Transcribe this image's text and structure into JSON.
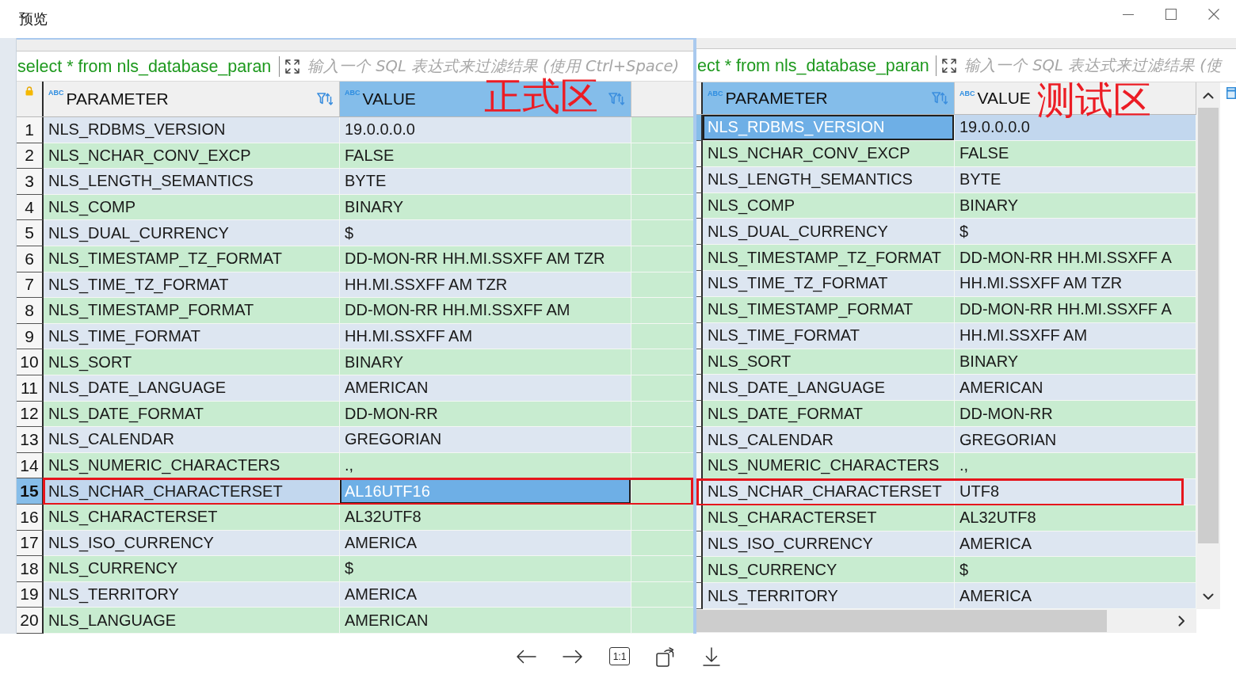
{
  "window": {
    "title": "预览"
  },
  "panels": [
    {
      "query": "select * from nls_database_paran",
      "filter_placeholder": "输入一个 SQL 表达式来过滤结果 (使用 Ctrl+Space)",
      "annotation": "正式区",
      "columns": [
        {
          "type": "ABC",
          "label": "PARAMETER",
          "selected": false,
          "filter_icon": true
        },
        {
          "type": "ABC",
          "label": "VALUE",
          "selected": true,
          "filter_icon": true
        }
      ],
      "rows": [
        {
          "number": "1",
          "selected": false,
          "outlined": false,
          "cells": [
            {
              "text": "NLS_RDBMS_VERSION",
              "selected": false
            },
            {
              "text": "19.0.0.0.0",
              "selected": false
            }
          ]
        },
        {
          "number": "2",
          "selected": false,
          "outlined": false,
          "cells": [
            {
              "text": "NLS_NCHAR_CONV_EXCP",
              "selected": false
            },
            {
              "text": "FALSE",
              "selected": false
            }
          ]
        },
        {
          "number": "3",
          "selected": false,
          "outlined": false,
          "cells": [
            {
              "text": "NLS_LENGTH_SEMANTICS",
              "selected": false
            },
            {
              "text": "BYTE",
              "selected": false
            }
          ]
        },
        {
          "number": "4",
          "selected": false,
          "outlined": false,
          "cells": [
            {
              "text": "NLS_COMP",
              "selected": false
            },
            {
              "text": "BINARY",
              "selected": false
            }
          ]
        },
        {
          "number": "5",
          "selected": false,
          "outlined": false,
          "cells": [
            {
              "text": "NLS_DUAL_CURRENCY",
              "selected": false
            },
            {
              "text": "$",
              "selected": false
            }
          ]
        },
        {
          "number": "6",
          "selected": false,
          "outlined": false,
          "cells": [
            {
              "text": "NLS_TIMESTAMP_TZ_FORMAT",
              "selected": false
            },
            {
              "text": "DD-MON-RR HH.MI.SSXFF AM TZR",
              "selected": false
            }
          ]
        },
        {
          "number": "7",
          "selected": false,
          "outlined": false,
          "cells": [
            {
              "text": "NLS_TIME_TZ_FORMAT",
              "selected": false
            },
            {
              "text": "HH.MI.SSXFF AM TZR",
              "selected": false
            }
          ]
        },
        {
          "number": "8",
          "selected": false,
          "outlined": false,
          "cells": [
            {
              "text": "NLS_TIMESTAMP_FORMAT",
              "selected": false
            },
            {
              "text": "DD-MON-RR HH.MI.SSXFF AM",
              "selected": false
            }
          ]
        },
        {
          "number": "9",
          "selected": false,
          "outlined": false,
          "cells": [
            {
              "text": "NLS_TIME_FORMAT",
              "selected": false
            },
            {
              "text": "HH.MI.SSXFF AM",
              "selected": false
            }
          ]
        },
        {
          "number": "10",
          "selected": false,
          "outlined": false,
          "cells": [
            {
              "text": "NLS_SORT",
              "selected": false
            },
            {
              "text": "BINARY",
              "selected": false
            }
          ]
        },
        {
          "number": "11",
          "selected": false,
          "outlined": false,
          "cells": [
            {
              "text": "NLS_DATE_LANGUAGE",
              "selected": false
            },
            {
              "text": "AMERICAN",
              "selected": false
            }
          ]
        },
        {
          "number": "12",
          "selected": false,
          "outlined": false,
          "cells": [
            {
              "text": "NLS_DATE_FORMAT",
              "selected": false
            },
            {
              "text": "DD-MON-RR",
              "selected": false
            }
          ]
        },
        {
          "number": "13",
          "selected": false,
          "outlined": false,
          "cells": [
            {
              "text": "NLS_CALENDAR",
              "selected": false
            },
            {
              "text": "GREGORIAN",
              "selected": false
            }
          ]
        },
        {
          "number": "14",
          "selected": false,
          "outlined": false,
          "cells": [
            {
              "text": "NLS_NUMERIC_CHARACTERS",
              "selected": false
            },
            {
              "text": ".,",
              "selected": false
            }
          ]
        },
        {
          "number": "15",
          "selected": true,
          "outlined": true,
          "cells": [
            {
              "text": "NLS_NCHAR_CHARACTERSET",
              "selected": false
            },
            {
              "text": "AL16UTF16",
              "selected": true
            }
          ]
        },
        {
          "number": "16",
          "selected": false,
          "outlined": false,
          "cells": [
            {
              "text": "NLS_CHARACTERSET",
              "selected": false
            },
            {
              "text": "AL32UTF8",
              "selected": false
            }
          ]
        },
        {
          "number": "17",
          "selected": false,
          "outlined": false,
          "cells": [
            {
              "text": "NLS_ISO_CURRENCY",
              "selected": false
            },
            {
              "text": "AMERICA",
              "selected": false
            }
          ]
        },
        {
          "number": "18",
          "selected": false,
          "outlined": false,
          "cells": [
            {
              "text": "NLS_CURRENCY",
              "selected": false
            },
            {
              "text": "$",
              "selected": false
            }
          ]
        },
        {
          "number": "19",
          "selected": false,
          "outlined": false,
          "cells": [
            {
              "text": "NLS_TERRITORY",
              "selected": false
            },
            {
              "text": "AMERICA",
              "selected": false
            }
          ]
        },
        {
          "number": "20",
          "selected": false,
          "outlined": false,
          "cells": [
            {
              "text": "NLS_LANGUAGE",
              "selected": false
            },
            {
              "text": "AMERICAN",
              "selected": false
            }
          ]
        }
      ]
    },
    {
      "query": "ect * from nls_database_paran",
      "filter_placeholder": "输入一个 SQL 表达式来过滤结果 (使",
      "annotation": "测试区",
      "columns": [
        {
          "type": "ABC",
          "label": "PARAMETER",
          "selected": true,
          "filter_icon": true
        },
        {
          "type": "ABC",
          "label": "VALUE",
          "selected": false,
          "filter_icon": false
        }
      ],
      "rows": [
        {
          "selected": true,
          "outlined": false,
          "cells": [
            {
              "text": "NLS_RDBMS_VERSION",
              "selected": true
            },
            {
              "text": "19.0.0.0.0",
              "selected": false
            }
          ]
        },
        {
          "selected": false,
          "outlined": false,
          "cells": [
            {
              "text": "NLS_NCHAR_CONV_EXCP",
              "selected": false
            },
            {
              "text": "FALSE",
              "selected": false
            }
          ]
        },
        {
          "selected": false,
          "outlined": false,
          "cells": [
            {
              "text": "NLS_LENGTH_SEMANTICS",
              "selected": false
            },
            {
              "text": "BYTE",
              "selected": false
            }
          ]
        },
        {
          "selected": false,
          "outlined": false,
          "cells": [
            {
              "text": "NLS_COMP",
              "selected": false
            },
            {
              "text": "BINARY",
              "selected": false
            }
          ]
        },
        {
          "selected": false,
          "outlined": false,
          "cells": [
            {
              "text": "NLS_DUAL_CURRENCY",
              "selected": false
            },
            {
              "text": "$",
              "selected": false
            }
          ]
        },
        {
          "selected": false,
          "outlined": false,
          "cells": [
            {
              "text": "NLS_TIMESTAMP_TZ_FORMAT",
              "selected": false
            },
            {
              "text": "DD-MON-RR HH.MI.SSXFF A",
              "selected": false
            }
          ]
        },
        {
          "selected": false,
          "outlined": false,
          "cells": [
            {
              "text": "NLS_TIME_TZ_FORMAT",
              "selected": false
            },
            {
              "text": "HH.MI.SSXFF AM TZR",
              "selected": false
            }
          ]
        },
        {
          "selected": false,
          "outlined": false,
          "cells": [
            {
              "text": "NLS_TIMESTAMP_FORMAT",
              "selected": false
            },
            {
              "text": "DD-MON-RR HH.MI.SSXFF A",
              "selected": false
            }
          ]
        },
        {
          "selected": false,
          "outlined": false,
          "cells": [
            {
              "text": "NLS_TIME_FORMAT",
              "selected": false
            },
            {
              "text": "HH.MI.SSXFF AM",
              "selected": false
            }
          ]
        },
        {
          "selected": false,
          "outlined": false,
          "cells": [
            {
              "text": "NLS_SORT",
              "selected": false
            },
            {
              "text": "BINARY",
              "selected": false
            }
          ]
        },
        {
          "selected": false,
          "outlined": false,
          "cells": [
            {
              "text": "NLS_DATE_LANGUAGE",
              "selected": false
            },
            {
              "text": "AMERICAN",
              "selected": false
            }
          ]
        },
        {
          "selected": false,
          "outlined": false,
          "cells": [
            {
              "text": "NLS_DATE_FORMAT",
              "selected": false
            },
            {
              "text": "DD-MON-RR",
              "selected": false
            }
          ]
        },
        {
          "selected": false,
          "outlined": false,
          "cells": [
            {
              "text": "NLS_CALENDAR",
              "selected": false
            },
            {
              "text": "GREGORIAN",
              "selected": false
            }
          ]
        },
        {
          "selected": false,
          "outlined": false,
          "cells": [
            {
              "text": "NLS_NUMERIC_CHARACTERS",
              "selected": false
            },
            {
              "text": ".,",
              "selected": false
            }
          ]
        },
        {
          "selected": false,
          "outlined": true,
          "cells": [
            {
              "text": "NLS_NCHAR_CHARACTERSET",
              "selected": false
            },
            {
              "text": "UTF8",
              "selected": false
            }
          ]
        },
        {
          "selected": false,
          "outlined": false,
          "cells": [
            {
              "text": "NLS_CHARACTERSET",
              "selected": false
            },
            {
              "text": "AL32UTF8",
              "selected": false
            }
          ]
        },
        {
          "selected": false,
          "outlined": false,
          "cells": [
            {
              "text": "NLS_ISO_CURRENCY",
              "selected": false
            },
            {
              "text": "AMERICA",
              "selected": false
            }
          ]
        },
        {
          "selected": false,
          "outlined": false,
          "cells": [
            {
              "text": "NLS_CURRENCY",
              "selected": false
            },
            {
              "text": "$",
              "selected": false
            }
          ]
        },
        {
          "selected": false,
          "outlined": false,
          "cells": [
            {
              "text": "NLS_TERRITORY",
              "selected": false
            },
            {
              "text": "AMERICA",
              "selected": false
            }
          ]
        }
      ]
    }
  ],
  "toolbar": {
    "actual_size_label": "1:1"
  }
}
